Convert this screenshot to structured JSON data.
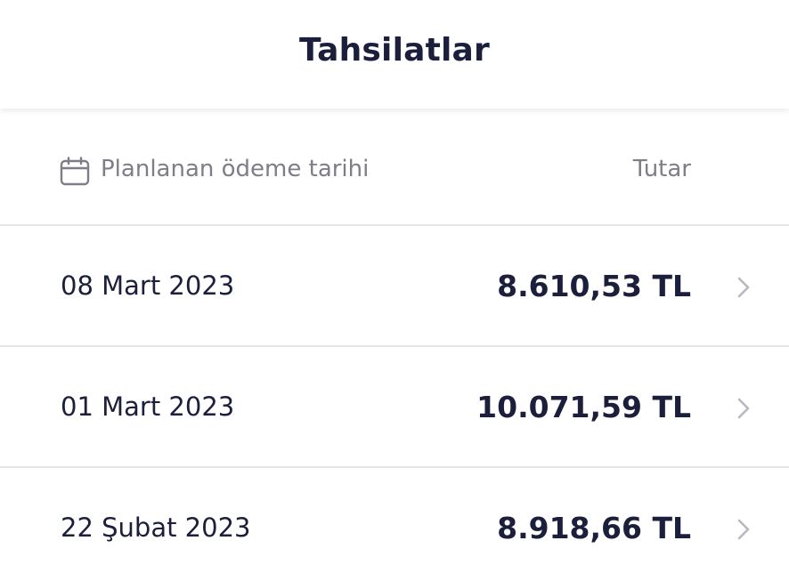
{
  "header": {
    "title": "Tahsilatlar"
  },
  "columns": {
    "date_label": "Planlanan ödeme tarihi",
    "date_icon": "calendar-icon",
    "amount_label": "Tutar"
  },
  "payments": [
    {
      "date": "08 Mart 2023",
      "amount": "8.610,53 TL"
    },
    {
      "date": "01 Mart 2023",
      "amount": "10.071,59 TL"
    },
    {
      "date": "22 Şubat 2023",
      "amount": "8.918,66 TL"
    }
  ],
  "colors": {
    "text_primary": "#1b1f3b",
    "text_secondary": "#7d7e88",
    "divider": "#e6e6ea",
    "chevron": "#b8b9c0"
  }
}
